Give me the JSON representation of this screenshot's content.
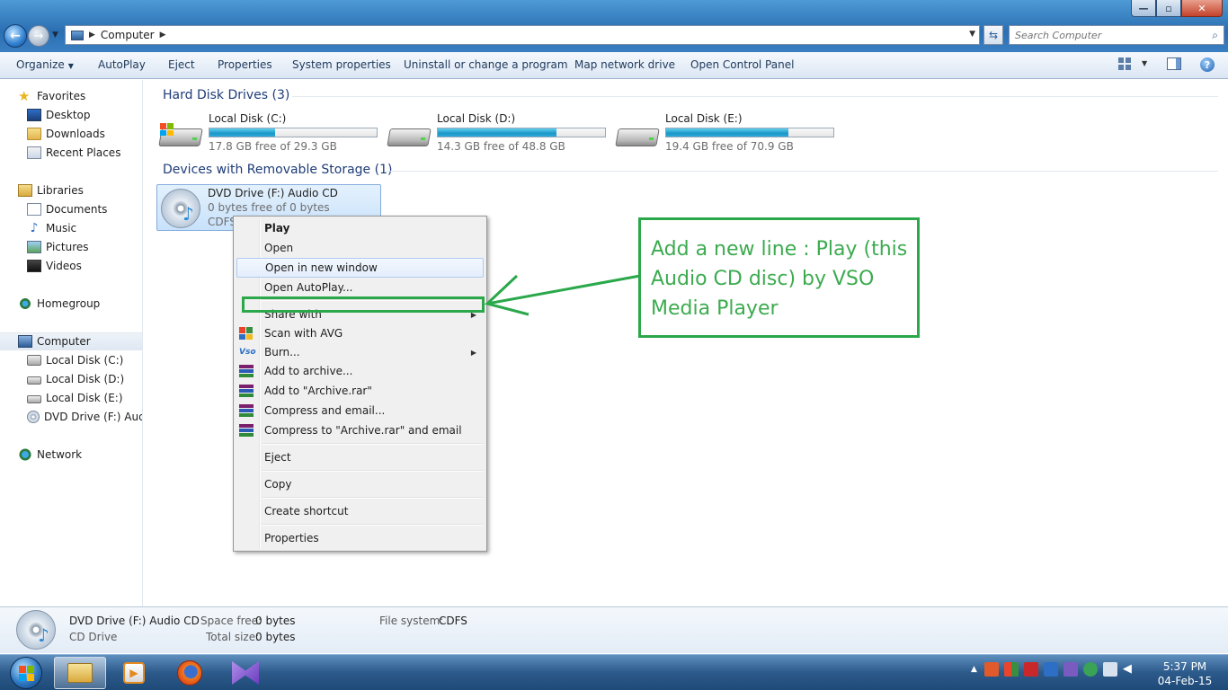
{
  "window": {
    "controls": {
      "minimize": "—",
      "maximize": "▫",
      "close": "✕"
    }
  },
  "address": {
    "path": "Computer",
    "search_placeholder": "Search Computer"
  },
  "commands": [
    "Organize",
    "AutoPlay",
    "Eject",
    "Properties",
    "System properties",
    "Uninstall or change a program",
    "Map network drive",
    "Open Control Panel"
  ],
  "sidebar": {
    "favorites": {
      "label": "Favorites",
      "items": [
        "Desktop",
        "Downloads",
        "Recent Places"
      ]
    },
    "libraries": {
      "label": "Libraries",
      "items": [
        "Documents",
        "Music",
        "Pictures",
        "Videos"
      ]
    },
    "homegroup": "Homegroup",
    "computer": {
      "label": "Computer",
      "items": [
        "Local Disk (C:)",
        "Local Disk (D:)",
        "Local Disk (E:)",
        "DVD Drive (F:) Audio CD"
      ]
    },
    "network": "Network"
  },
  "groups": {
    "hdd": "Hard Disk Drives (3)",
    "removable": "Devices with Removable Storage (1)"
  },
  "drives": [
    {
      "name": "Local Disk (C:)",
      "free": "17.8 GB free of 29.3 GB",
      "used_fraction": 0.39
    },
    {
      "name": "Local Disk (D:)",
      "free": "14.3 GB free of 48.8 GB",
      "used_fraction": 0.71
    },
    {
      "name": "Local Disk (E:)",
      "free": "19.4 GB free of 70.9 GB",
      "used_fraction": 0.73
    }
  ],
  "cd": {
    "name": "DVD Drive (F:) Audio CD",
    "free": "0 bytes free of 0 bytes",
    "fs": "CDFS"
  },
  "context_menu": {
    "play": "Play",
    "open": "Open",
    "open_new_window": "Open in new window",
    "open_autoplay": "Open AutoPlay...",
    "share_with": "Share with",
    "scan_avg": "Scan with AVG",
    "burn": "Burn...",
    "add_archive": "Add to archive...",
    "add_archive_rar": "Add to \"Archive.rar\"",
    "compress_email": "Compress and email...",
    "compress_rar_email": "Compress to \"Archive.rar\" and email",
    "eject": "Eject",
    "copy": "Copy",
    "create_shortcut": "Create shortcut",
    "properties": "Properties"
  },
  "annotation": {
    "line1": "Add a new line : Play (this",
    "line2": "Audio CD disc) by VSO",
    "line3": "Media Player",
    "color": "#3cab4f"
  },
  "details": {
    "name": "DVD Drive (F:) Audio CD",
    "type": "CD Drive",
    "space_free_label": "Space free:",
    "space_free": "0 bytes",
    "total_size_label": "Total size:",
    "total_size": "0 bytes",
    "fs_label": "File system:",
    "fs": "CDFS"
  },
  "clock": {
    "time": "5:37 PM",
    "date": "04-Feb-15"
  }
}
